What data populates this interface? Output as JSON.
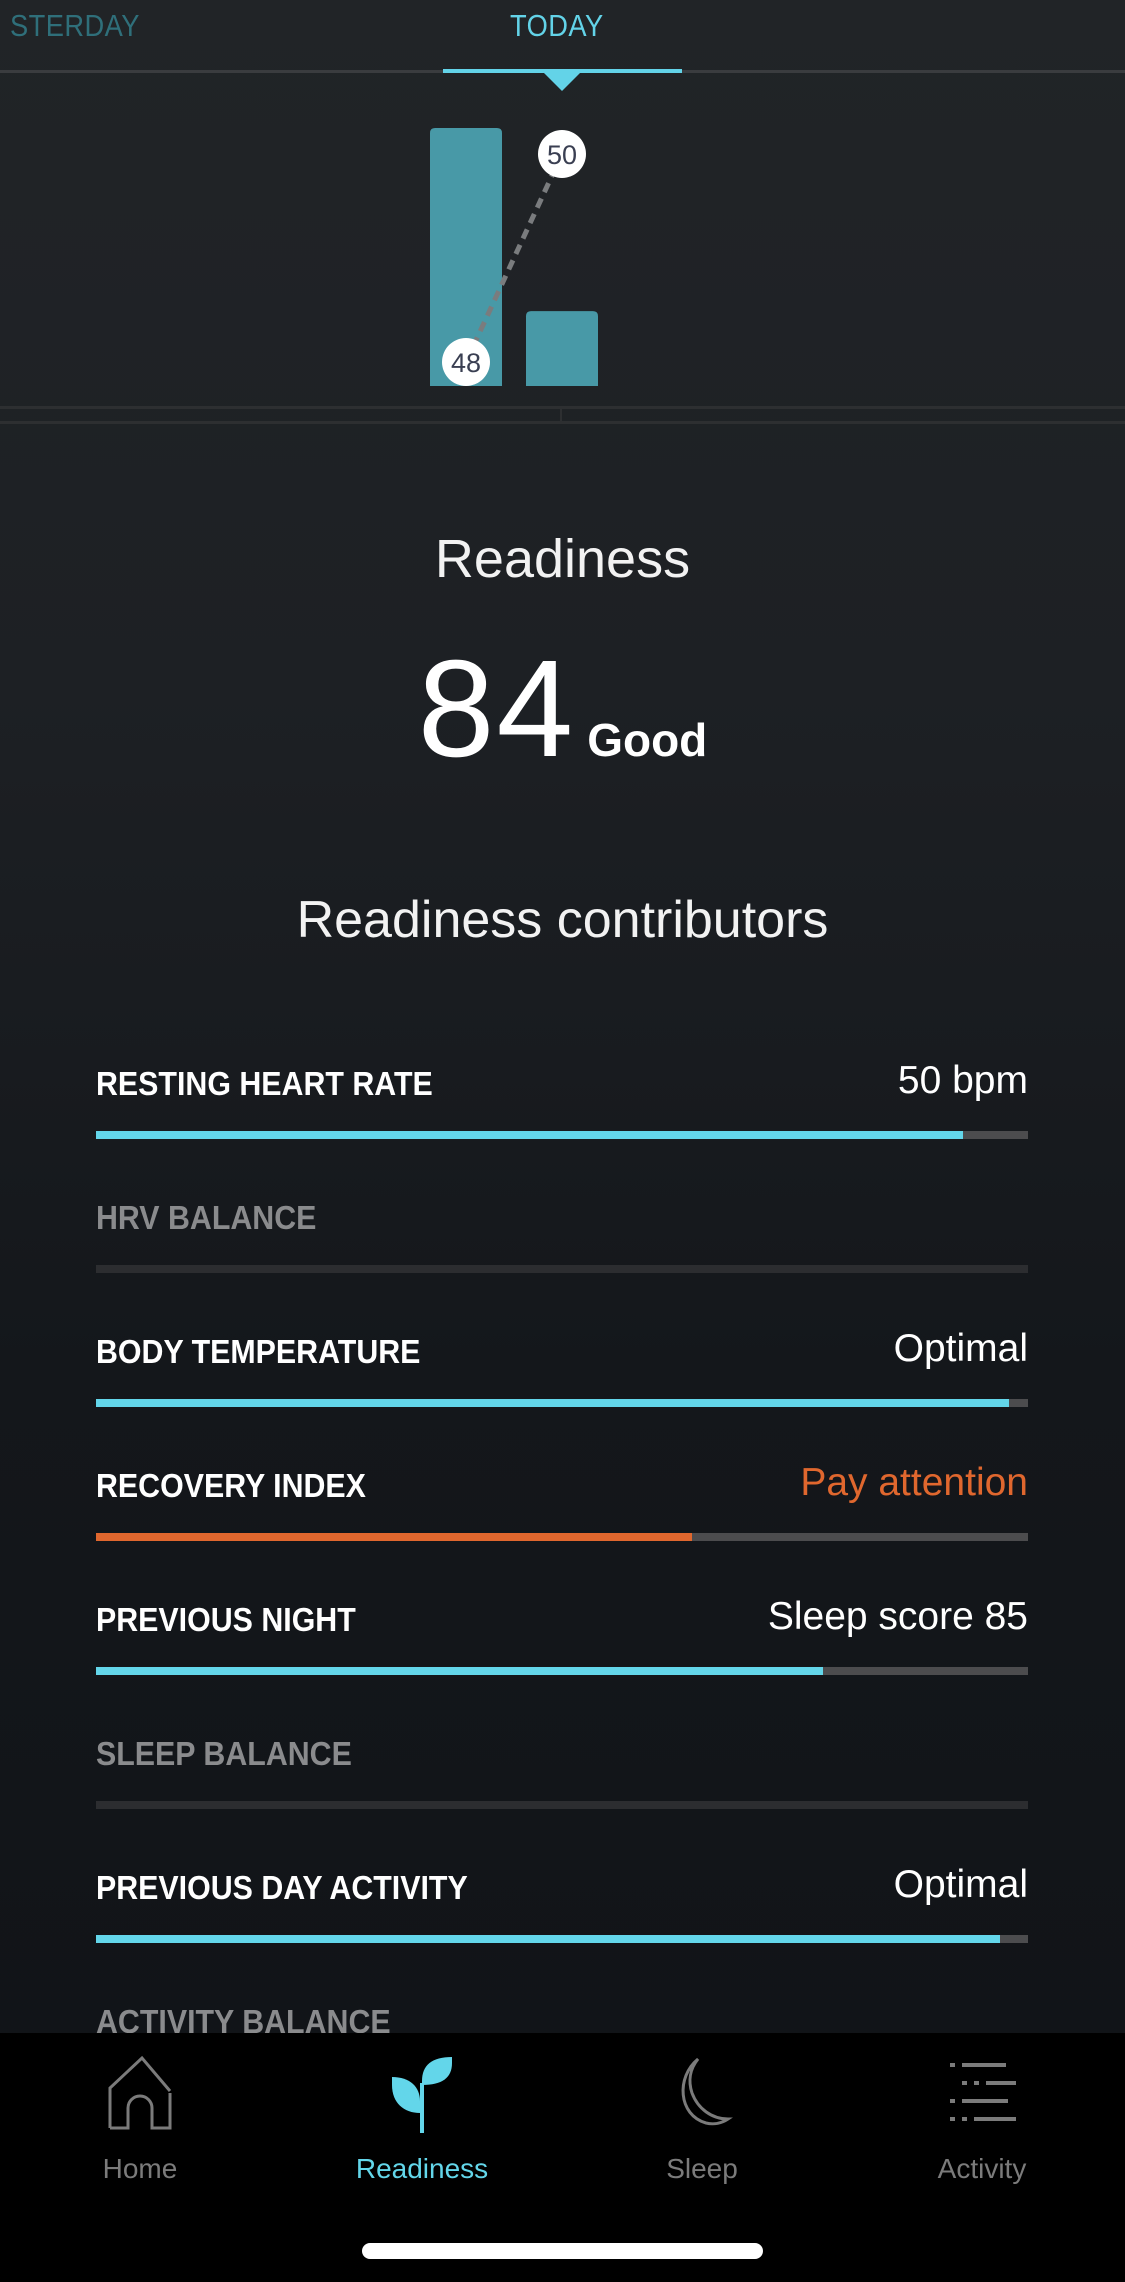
{
  "date_tabs": {
    "items": [
      {
        "label": "YESTERDAY",
        "visible_text": "STERDAY",
        "active": false
      },
      {
        "label": "TODAY",
        "active": true
      }
    ]
  },
  "chart_data": {
    "type": "bar",
    "title": "",
    "categories": [
      "previous",
      "today"
    ],
    "series": [
      {
        "name": "bar",
        "values": [
          100,
          29
        ]
      }
    ],
    "line_series": {
      "name": "resting-heart-rate-trend",
      "points": [
        {
          "category": "previous",
          "value": 48,
          "label": "48"
        },
        {
          "category": "today",
          "value": 50,
          "label": "50"
        }
      ],
      "style": "dashed"
    },
    "ylim": [
      0,
      100
    ],
    "grid": false,
    "xlabel": "",
    "ylabel": ""
  },
  "score": {
    "title": "Readiness",
    "value": "84",
    "label": "Good"
  },
  "contributors": {
    "title": "Readiness contributors",
    "items": [
      {
        "name": "RESTING HEART RATE",
        "value": "50 bpm",
        "progress": 0.93,
        "status": "normal"
      },
      {
        "name": "HRV BALANCE",
        "value": "",
        "progress": 0,
        "status": "muted"
      },
      {
        "name": "BODY TEMPERATURE",
        "value": "Optimal",
        "progress": 0.98,
        "status": "normal"
      },
      {
        "name": "RECOVERY INDEX",
        "value": "Pay attention",
        "progress": 0.64,
        "status": "warning"
      },
      {
        "name": "PREVIOUS NIGHT",
        "value": "Sleep score 85",
        "progress": 0.78,
        "status": "normal"
      },
      {
        "name": "SLEEP BALANCE",
        "value": "",
        "progress": 0,
        "status": "muted"
      },
      {
        "name": "PREVIOUS DAY ACTIVITY",
        "value": "Optimal",
        "progress": 0.97,
        "status": "normal"
      },
      {
        "name": "ACTIVITY BALANCE",
        "value": "",
        "progress": null,
        "status": "muted"
      }
    ]
  },
  "colors": {
    "accent": "#63d6ea",
    "warning": "#e0672e",
    "bar": "#4899a7",
    "inactive": "#7b7b7b"
  },
  "nav": {
    "items": [
      {
        "label": "Home",
        "icon": "home-icon",
        "active": false
      },
      {
        "label": "Readiness",
        "icon": "sprout-icon",
        "active": true
      },
      {
        "label": "Sleep",
        "icon": "moon-icon",
        "active": false
      },
      {
        "label": "Activity",
        "icon": "activity-list-icon",
        "active": false
      }
    ]
  }
}
